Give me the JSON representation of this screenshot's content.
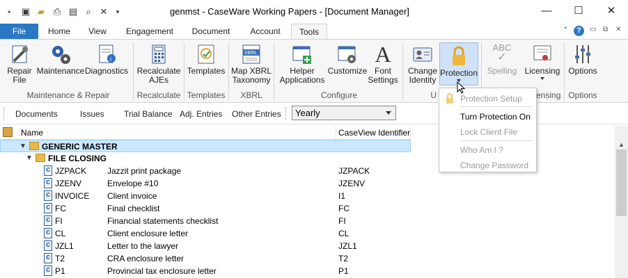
{
  "window": {
    "title": "genmst - CaseWare Working Papers - [Document Manager]"
  },
  "quick_access": [
    "app-icon",
    "monitor-icon",
    "open-folder-icon",
    "print-icon",
    "print-preview-icon",
    "find-icon",
    "close-x-icon",
    "dropdown-arrow-icon"
  ],
  "window_controls": {
    "minimize": "—",
    "maximize": "☐",
    "close": "✕"
  },
  "tabs": [
    "File",
    "Home",
    "View",
    "Engagement",
    "Document",
    "Account",
    "Tools"
  ],
  "ribbon_right": {
    "caret": "⌃",
    "help": "?",
    "restore1": "▭",
    "restore2": "⧉",
    "close": "✕"
  },
  "ribbon": {
    "buttons": {
      "repair_file": "Repair\nFile",
      "maintenance": "Maintenance",
      "diagnostics": "Diagnostics",
      "recalculate": "Recalculate\nAJEs",
      "templates": "Templates",
      "map_xbrl": "Map XBRL\nTaxonomy",
      "helper": "Helper\nApplications",
      "customize": "Customize",
      "font_settings": "Font\nSettings",
      "change_identity": "Change\nIdentity",
      "protection": "Protection",
      "spelling": "Spelling",
      "licensing": "Licensing",
      "options": "Options"
    },
    "icon_texts": {
      "xbrl": "XBRL",
      "abc": "ABC"
    },
    "groups": {
      "maint": "Maintenance & Repair",
      "recalc": "Recalculate",
      "templates": "Templates",
      "xbrl": "XBRL",
      "configure": "Configure",
      "u": "U",
      "licensing": "ensing",
      "options": "Options"
    }
  },
  "navbar": {
    "items": [
      "Documents",
      "Issues",
      "Trial Balance",
      "Adj. Entries",
      "Other Entries"
    ],
    "period": "Yearly"
  },
  "columns": {
    "name": "Name",
    "caseview": "CaseView Identifier"
  },
  "tree": {
    "root": "GENERIC MASTER",
    "folder": "FILE CLOSING",
    "rows": [
      {
        "code": "JZPACK",
        "name": "Jazzit print package",
        "cv": "JZPACK"
      },
      {
        "code": "JZENV",
        "name": "Envelope #10",
        "cv": "JZENV"
      },
      {
        "code": "INVOICE",
        "name": "Client invoice",
        "cv": "I1"
      },
      {
        "code": "FC",
        "name": "Final checklist",
        "cv": "FC"
      },
      {
        "code": "FI",
        "name": "Financial statements checklist",
        "cv": "FI"
      },
      {
        "code": "CL",
        "name": "Client enclosure letter",
        "cv": "CL"
      },
      {
        "code": "JZL1",
        "name": "Letter to the lawyer",
        "cv": "JZL1"
      },
      {
        "code": "T2",
        "name": "CRA enclosure letter",
        "cv": "T2"
      },
      {
        "code": "P1",
        "name": "Provincial tax enclosure letter",
        "cv": "P1"
      }
    ]
  },
  "protection_menu": {
    "setup": "Protection Setup",
    "turn_on": "Turn Protection On",
    "lock": "Lock Client File",
    "whoami": "Who Am I ?",
    "change_pw": "Change Password"
  },
  "colors": {
    "file_tab": "#2b78c5",
    "selection": "#cce8ff",
    "ribbon_bg": "#f6f6f6",
    "protection_highlight": "#cfe2f7"
  }
}
